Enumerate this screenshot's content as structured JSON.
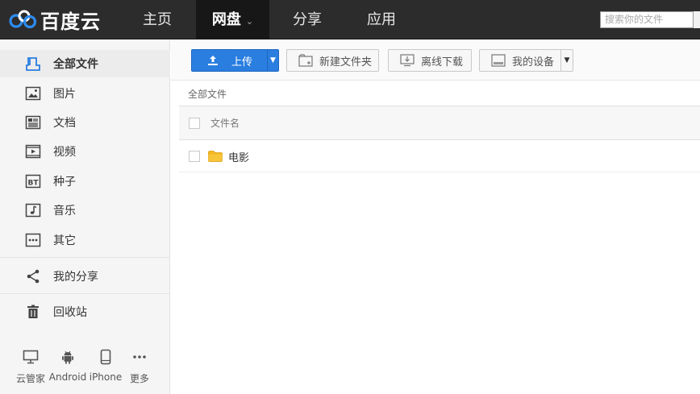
{
  "header": {
    "logo_text": "百度云",
    "nav": [
      {
        "label": "主页"
      },
      {
        "label": "网盘",
        "chevron": "⌄"
      },
      {
        "label": "分享"
      },
      {
        "label": "应用"
      }
    ],
    "search_placeholder": "搜索你的文件"
  },
  "sidebar": {
    "items": [
      {
        "label": "全部文件",
        "icon": "all-files-icon"
      },
      {
        "label": "图片",
        "icon": "image-icon"
      },
      {
        "label": "文档",
        "icon": "document-icon"
      },
      {
        "label": "视频",
        "icon": "video-icon"
      },
      {
        "label": "种子",
        "icon": "bt-icon"
      },
      {
        "label": "音乐",
        "icon": "music-icon"
      },
      {
        "label": "其它",
        "icon": "other-icon"
      },
      {
        "label": "我的分享",
        "icon": "share-icon"
      },
      {
        "label": "回收站",
        "icon": "trash-icon"
      }
    ],
    "devices": [
      {
        "label": "云管家",
        "icon": "desktop-icon"
      },
      {
        "label": "Android",
        "icon": "android-icon"
      },
      {
        "label": "iPhone",
        "icon": "phone-icon"
      },
      {
        "label": "更多",
        "icon": "more-icon"
      }
    ]
  },
  "toolbar": {
    "upload_label": "上传",
    "new_folder_label": "新建文件夹",
    "offline_label": "离线下载",
    "device_label": "我的设备"
  },
  "content": {
    "breadcrumb": "全部文件",
    "column_filename": "文件名",
    "files": [
      {
        "name": "电影",
        "type": "folder"
      }
    ]
  },
  "colors": {
    "topbar": "#2c2c2c",
    "upload_button": "#2a7ee0",
    "folder": "#f5b820"
  }
}
